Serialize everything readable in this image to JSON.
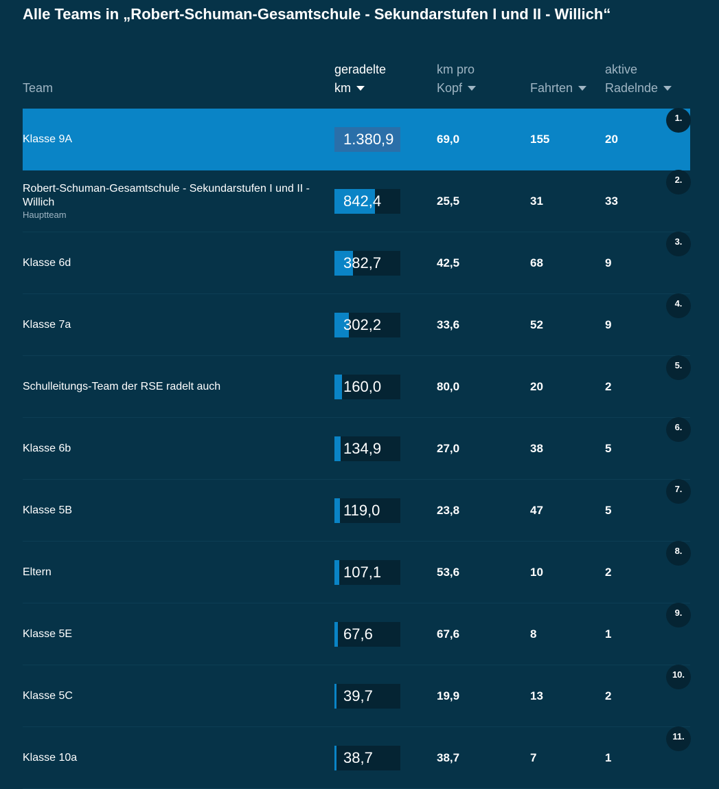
{
  "title": "Alle Teams in „Robert-Schuman-Gesamtschule - Sekundarstufen I und II - Willich“",
  "columns": {
    "team": "Team",
    "km_line1": "geradelte",
    "km_line2": "km",
    "kopf_line1": "km pro",
    "kopf_line2": "Kopf",
    "fahrten": "Fahrten",
    "aktiv_line1": "aktive",
    "aktiv_line2": "Radelnde"
  },
  "rows": [
    {
      "rank": "1.",
      "name": "Klasse 9A",
      "sub": "",
      "km": "1.380,9",
      "km_value": 1380.9,
      "kopf": "69,0",
      "fahrten": "155",
      "aktiv": "20"
    },
    {
      "rank": "2.",
      "name": "Robert-Schuman-Gesamtschule - Sekundarstufen I und II - Willich",
      "sub": "Hauptteam",
      "km": "842,4",
      "km_value": 842.4,
      "kopf": "25,5",
      "fahrten": "31",
      "aktiv": "33"
    },
    {
      "rank": "3.",
      "name": "Klasse 6d",
      "sub": "",
      "km": "382,7",
      "km_value": 382.7,
      "kopf": "42,5",
      "fahrten": "68",
      "aktiv": "9"
    },
    {
      "rank": "4.",
      "name": "Klasse 7a",
      "sub": "",
      "km": "302,2",
      "km_value": 302.2,
      "kopf": "33,6",
      "fahrten": "52",
      "aktiv": "9"
    },
    {
      "rank": "5.",
      "name": "Schulleitungs-Team der RSE radelt auch",
      "sub": "",
      "km": "160,0",
      "km_value": 160.0,
      "kopf": "80,0",
      "fahrten": "20",
      "aktiv": "2"
    },
    {
      "rank": "6.",
      "name": "Klasse 6b",
      "sub": "",
      "km": "134,9",
      "km_value": 134.9,
      "kopf": "27,0",
      "fahrten": "38",
      "aktiv": "5"
    },
    {
      "rank": "7.",
      "name": "Klasse 5B",
      "sub": "",
      "km": "119,0",
      "km_value": 119.0,
      "kopf": "23,8",
      "fahrten": "47",
      "aktiv": "5"
    },
    {
      "rank": "8.",
      "name": "Eltern",
      "sub": "",
      "km": "107,1",
      "km_value": 107.1,
      "kopf": "53,6",
      "fahrten": "10",
      "aktiv": "2"
    },
    {
      "rank": "9.",
      "name": "Klasse 5E",
      "sub": "",
      "km": "67,6",
      "km_value": 67.6,
      "kopf": "67,6",
      "fahrten": "8",
      "aktiv": "1"
    },
    {
      "rank": "10.",
      "name": "Klasse 5C",
      "sub": "",
      "km": "39,7",
      "km_value": 39.7,
      "kopf": "19,9",
      "fahrten": "13",
      "aktiv": "2"
    },
    {
      "rank": "11.",
      "name": "Klasse 10a",
      "sub": "",
      "km": "38,7",
      "km_value": 38.7,
      "kopf": "38,7",
      "fahrten": "7",
      "aktiv": "1"
    }
  ],
  "colors": {
    "background": "#063348",
    "highlight": "#0a84c6",
    "bar": "#0a84c6",
    "bar_track": "#052433",
    "muted_text": "#9fb5c3"
  }
}
